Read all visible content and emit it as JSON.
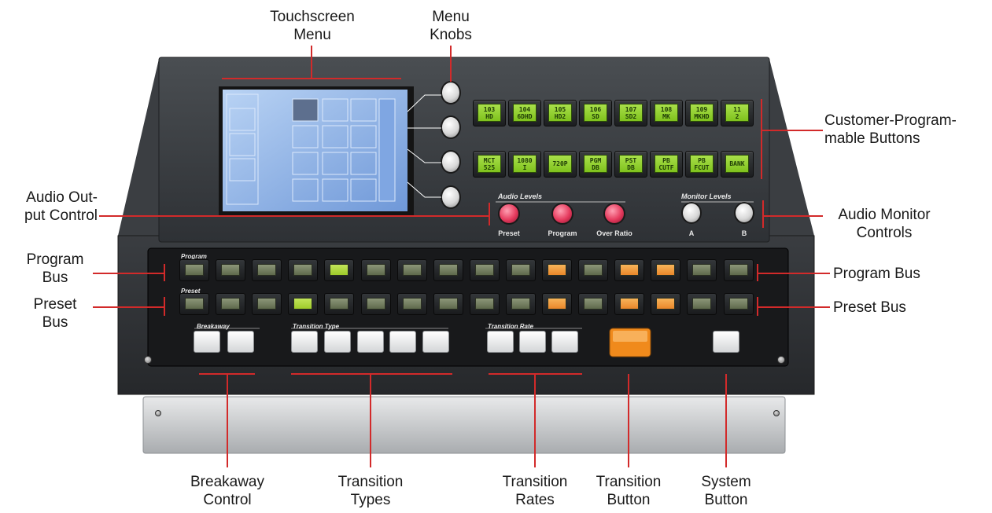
{
  "callouts": {
    "touchscreen_menu": [
      "Touchscreen",
      "Menu"
    ],
    "menu_knobs": [
      "Menu",
      "Knobs"
    ],
    "customer_buttons": [
      "Customer-Program-",
      "mable Buttons"
    ],
    "audio_output": [
      "Audio Out-",
      "put Control"
    ],
    "audio_monitor": [
      "Audio Monitor",
      "Controls"
    ],
    "program_bus_left": [
      "Program",
      "Bus"
    ],
    "preset_bus_left": [
      "Preset",
      "Bus"
    ],
    "program_bus_right": "Program Bus",
    "preset_bus_right": "Preset Bus",
    "breakaway": [
      "Breakaway",
      "Control"
    ],
    "transition_types": [
      "Transition",
      "Types"
    ],
    "transition_rates": [
      "Transition",
      "Rates"
    ],
    "transition_button": [
      "Transition",
      "Button"
    ],
    "system_button": [
      "System",
      "Button"
    ]
  },
  "panel": {
    "audio_levels_title": "Audio Levels",
    "monitor_levels_title": "Monitor Levels",
    "audio_knobs": [
      "Preset",
      "Program",
      "Over Ratio"
    ],
    "monitor_knobs": [
      "A",
      "B"
    ],
    "program_row_title": "Program",
    "preset_row_title": "Preset",
    "breakaway_title": "Breakaway",
    "transition_type_title": "Transition Type",
    "transition_rate_title": "Transition Rate"
  },
  "programmable_buttons": {
    "row1": [
      "103\nHD",
      "104\n6DHD",
      "105\nHD2",
      "106\nSD",
      "107\nSD2",
      "108\nMK",
      "109\nMKHD",
      "11\n2"
    ],
    "row2": [
      "MCT\n525",
      "1080\nI",
      "720P",
      "PGM\nDB",
      "PST\nDB",
      "PB\nCUTF",
      "PB\nFCUT",
      "BANK"
    ]
  },
  "bus_states": {
    "program": [
      "dim",
      "dim",
      "dim",
      "dim",
      "lit",
      "dim",
      "dim",
      "dim",
      "dim",
      "dim",
      "amber",
      "dim",
      "amber",
      "amber",
      "dim",
      "dim"
    ],
    "preset": [
      "dim",
      "dim",
      "dim",
      "lit",
      "dim",
      "dim",
      "dim",
      "dim",
      "dim",
      "dim",
      "amber",
      "dim",
      "amber",
      "amber",
      "dim",
      "dim"
    ]
  },
  "colors": {
    "callout_line": "#d22a2a",
    "lcd_green": "#a9e04a",
    "transition_orange": "#f08a1c",
    "panel_dark": "#2d3034"
  }
}
